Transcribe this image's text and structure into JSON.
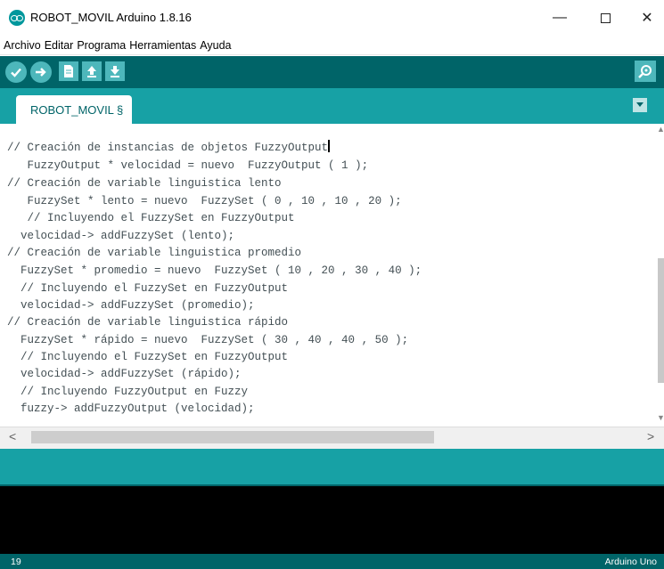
{
  "window": {
    "title": "ROBOT_MOVIL Arduino 1.8.16",
    "minimize": "—",
    "close": "✕"
  },
  "menu": [
    "Archivo",
    "Editar",
    "Programa",
    "Herramientas",
    "Ayuda"
  ],
  "toolbar": {
    "buttons": [
      "verify-icon",
      "upload-icon",
      "new-icon",
      "open-icon",
      "save-icon"
    ],
    "serial_monitor": "serial-monitor-icon"
  },
  "tab": {
    "label": "ROBOT_MOVIL §"
  },
  "code": [
    "// Creación de instancias de objetos FuzzyOutput",
    "   FuzzyOutput * velocidad = nuevo  FuzzyOutput ( 1 );",
    "// Creación de variable linguistica lento",
    "   FuzzySet * lento = nuevo  FuzzySet ( 0 , 10 , 10 , 20 );",
    "   // Incluyendo el FuzzySet en FuzzyOutput",
    "  velocidad-> addFuzzySet (lento);",
    "// Creación de variable linguistica promedio",
    "  FuzzySet * promedio = nuevo  FuzzySet ( 10 , 20 , 30 , 40 );",
    "  // Incluyendo el FuzzySet en FuzzyOutput",
    "  velocidad-> addFuzzySet (promedio);",
    "// Creación de variable linguistica rápido",
    "  FuzzySet * rápido = nuevo  FuzzySet ( 30 , 40 , 40 , 50 );",
    "  // Incluyendo el FuzzySet en FuzzyOutput",
    "  velocidad-> addFuzzySet (rápido);",
    "  // Incluyendo FuzzyOutput en Fuzzy",
    "  fuzzy-> addFuzzyOutput (velocidad);"
  ],
  "footer": {
    "line": "19",
    "board": "Arduino Uno"
  },
  "colors": {
    "toolbar": "#006468",
    "tabstrip": "#17a1a5",
    "button": "#4db7bb",
    "console": "#000000"
  }
}
